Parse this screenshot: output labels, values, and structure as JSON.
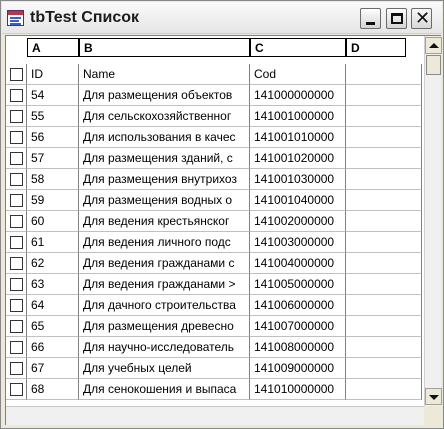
{
  "window": {
    "title": "tbTest Список",
    "buttons": {
      "minimize_icon": "minimize-icon",
      "maximize_icon": "maximize-icon",
      "close_icon": "close-icon",
      "close_glyph": "✕"
    }
  },
  "grid": {
    "column_letters": [
      "A",
      "B",
      "C",
      "D"
    ],
    "column_names": [
      "ID",
      "Name",
      "Cod",
      ""
    ],
    "rows": [
      {
        "id": "54",
        "name": "Для размещения объектов",
        "cod": "141000000000"
      },
      {
        "id": "55",
        "name": "Для сельскохозяйственног",
        "cod": "141001000000"
      },
      {
        "id": "56",
        "name": "Для использования в качес",
        "cod": "141001010000"
      },
      {
        "id": "57",
        "name": "Для размещения зданий, с",
        "cod": "141001020000"
      },
      {
        "id": "58",
        "name": "Для размещения внутрихоз",
        "cod": "141001030000"
      },
      {
        "id": "59",
        "name": "Для размещения водных о",
        "cod": "141001040000"
      },
      {
        "id": "60",
        "name": "Для ведения крестьянског",
        "cod": "141002000000"
      },
      {
        "id": "61",
        "name": "Для ведения личного подс",
        "cod": "141003000000"
      },
      {
        "id": "62",
        "name": "Для ведения гражданами с",
        "cod": "141004000000"
      },
      {
        "id": "63",
        "name": "Для ведения гражданами >",
        "cod": "141005000000"
      },
      {
        "id": "64",
        "name": "Для дачного строительства",
        "cod": "141006000000"
      },
      {
        "id": "65",
        "name": "Для размещения древесно",
        "cod": "141007000000"
      },
      {
        "id": "66",
        "name": "Для научно-исследователь",
        "cod": "141008000000"
      },
      {
        "id": "67",
        "name": "Для учебных целей",
        "cod": "141009000000"
      },
      {
        "id": "68",
        "name": "Для сенокошения и выпаса",
        "cod": "141010000000"
      }
    ]
  }
}
